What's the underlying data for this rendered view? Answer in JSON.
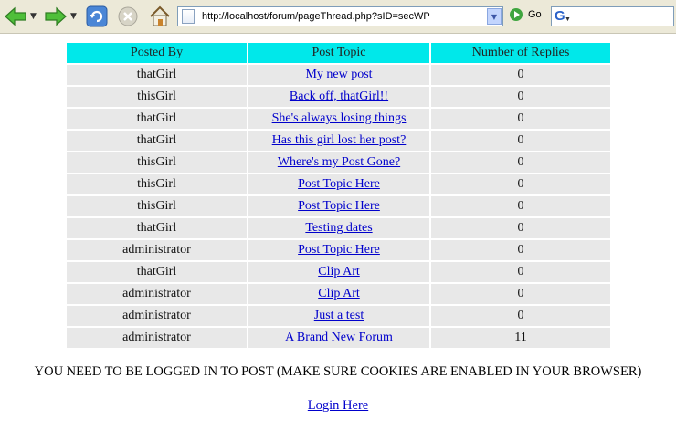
{
  "browser": {
    "address_url": "http://localhost/forum/pageThread.php?sID=secWP",
    "go_label": "Go",
    "search_logo": "G",
    "icons": [
      "back-icon",
      "forward-icon",
      "refresh-icon",
      "stop-icon",
      "home-icon",
      "page-icon",
      "go-icon",
      "google-icon"
    ]
  },
  "table": {
    "headers": [
      "Posted By",
      "Post Topic",
      "Number of Replies"
    ],
    "rows": [
      {
        "author": "thatGirl",
        "topic": "My new post",
        "replies": "0"
      },
      {
        "author": "thisGirl",
        "topic": "Back off, thatGirl!!",
        "replies": "0"
      },
      {
        "author": "thatGirl",
        "topic": "She's always losing things",
        "replies": "0"
      },
      {
        "author": "thatGirl",
        "topic": "Has this girl lost her post?",
        "replies": "0"
      },
      {
        "author": "thisGirl",
        "topic": "Where's my Post Gone?",
        "replies": "0"
      },
      {
        "author": "thisGirl",
        "topic": "Post Topic Here",
        "replies": "0"
      },
      {
        "author": "thisGirl",
        "topic": "Post Topic Here",
        "replies": "0"
      },
      {
        "author": "thatGirl",
        "topic": "Testing dates",
        "replies": "0"
      },
      {
        "author": "administrator",
        "topic": "Post Topic Here",
        "replies": "0"
      },
      {
        "author": "thatGirl",
        "topic": "Clip Art",
        "replies": "0"
      },
      {
        "author": "administrator",
        "topic": "Clip Art",
        "replies": "0"
      },
      {
        "author": "administrator",
        "topic": "Just a test",
        "replies": "0"
      },
      {
        "author": "administrator",
        "topic": "A Brand New Forum",
        "replies": "11"
      }
    ]
  },
  "notice": "YOU NEED TO BE LOGGED IN TO POST (MAKE SURE COOKIES ARE ENABLED IN YOUR BROWSER)",
  "login_link": "Login Here",
  "colors": {
    "header_bg": "#00e8ea",
    "row_bg": "#e8e8e8",
    "link": "#0000cc"
  }
}
